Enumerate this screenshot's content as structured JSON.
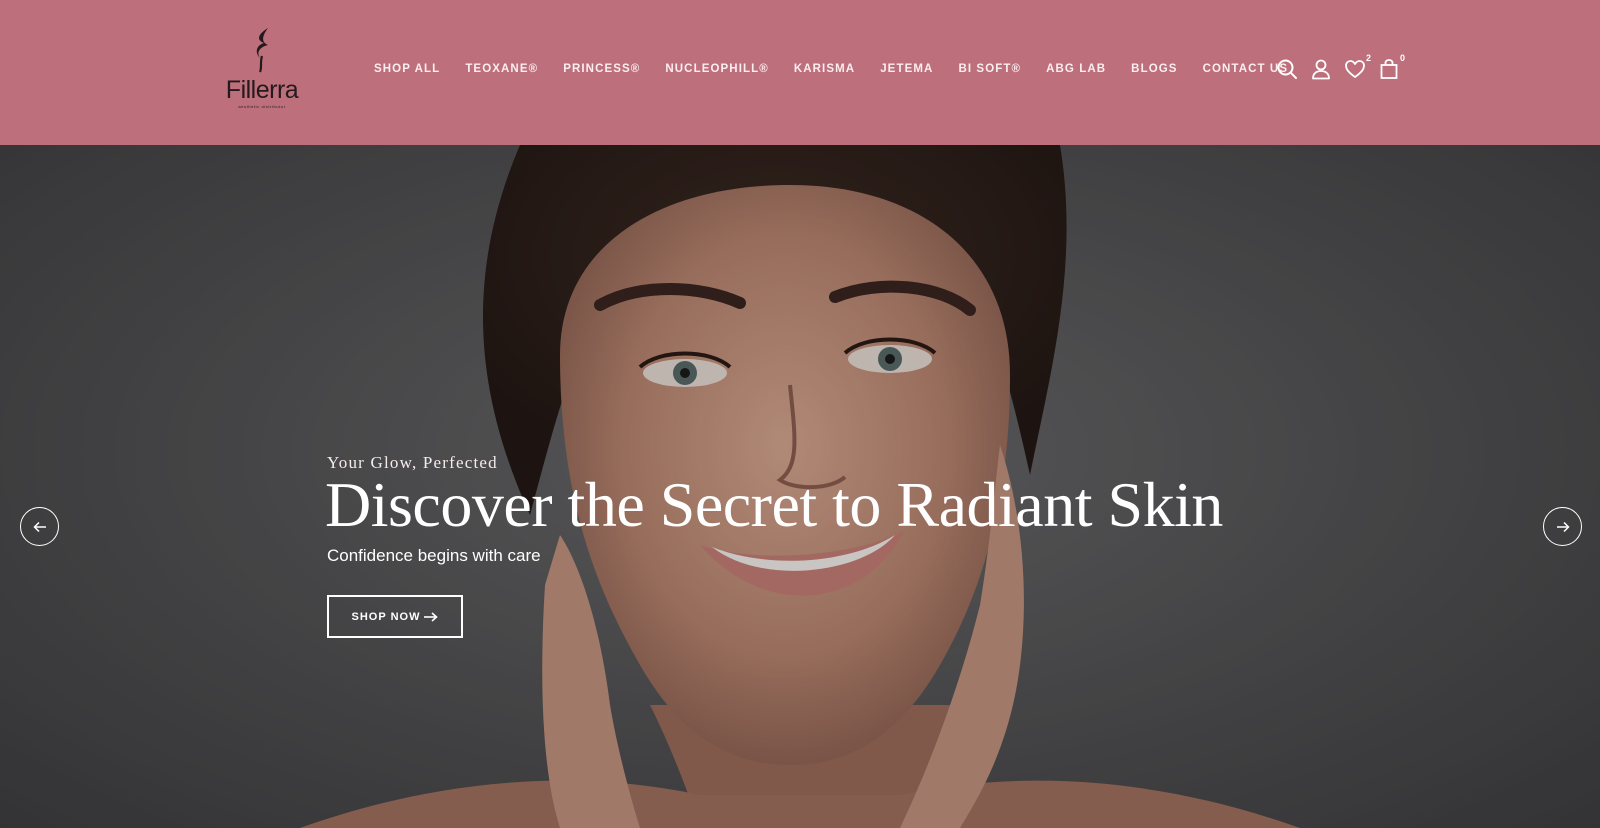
{
  "brand": {
    "name": "Fillerra",
    "tagline": "aesthetic distributor",
    "header_bg": "#bd6f7b"
  },
  "nav": {
    "items": [
      {
        "label": "SHOP ALL"
      },
      {
        "label": "TEOXANE®"
      },
      {
        "label": "PRINCESS®"
      },
      {
        "label": "NUCLEOPHILL®"
      },
      {
        "label": "KARISMA"
      },
      {
        "label": "JETEMA"
      },
      {
        "label": "BI SOFT®"
      },
      {
        "label": "ABG LAB"
      },
      {
        "label": "BLOGS"
      },
      {
        "label": "CONTACT US"
      }
    ]
  },
  "header_icons": {
    "search": "search-icon",
    "account": "user-icon",
    "wishlist": {
      "icon": "heart-icon",
      "count": "2"
    },
    "cart": {
      "icon": "shopping-bag-icon",
      "count": "0"
    }
  },
  "hero": {
    "kicker": "Your Glow, Perfected",
    "headline": "Discover the Secret to Radiant Skin",
    "subline": "Confidence begins with care",
    "cta_label": "SHOP NOW",
    "cta_icon": "arrow-right-icon",
    "prev_icon": "arrow-left-icon",
    "next_icon": "arrow-right-icon"
  }
}
